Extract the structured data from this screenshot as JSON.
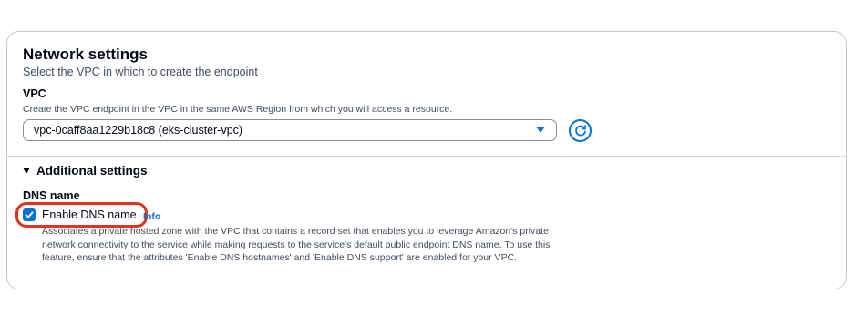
{
  "network": {
    "title": "Network settings",
    "description": "Select the VPC in which to create the endpoint"
  },
  "vpc": {
    "label": "VPC",
    "description": "Create the VPC endpoint in the VPC in the same AWS Region from which you will access a resource.",
    "selected": "vpc-0caff8aa1229b18c8 (eks-cluster-vpc)",
    "caret_icon": "caret-down-icon",
    "refresh_icon": "refresh-icon"
  },
  "additional": {
    "label": "Additional settings",
    "expanded": true
  },
  "dns": {
    "label": "DNS name",
    "checkbox_label": "Enable DNS name",
    "checked": true,
    "info": "Info",
    "description": "Associates a private hosted zone with the VPC that contains a record set that enables you to leverage Amazon's private network connectivity to the service while making requests to the service's default public endpoint DNS name. To use this feature, ensure that the attributes 'Enable DNS hostnames' and 'Enable DNS support' are enabled for your VPC."
  },
  "colors": {
    "accent": "#0972d3",
    "highlight": "#e0341c",
    "border": "#c6c6cd"
  }
}
